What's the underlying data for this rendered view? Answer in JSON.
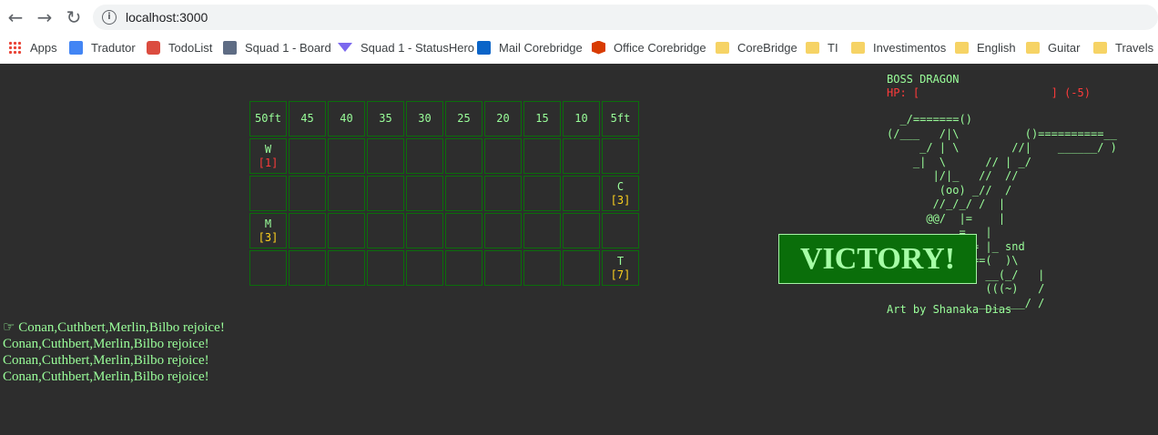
{
  "browser": {
    "url": "localhost:3000",
    "back_icon": "arrow-left-icon",
    "forward_icon": "arrow-right-icon",
    "reload_icon": "reload-icon",
    "info_icon": "info-icon",
    "bookmarks": [
      {
        "label": "Apps",
        "icon": "apps-grid-icon"
      },
      {
        "label": "Tradutor",
        "icon": "translate-icon"
      },
      {
        "label": "TodoList",
        "icon": "todoist-icon"
      },
      {
        "label": "Squad 1 - Board",
        "icon": "jira-board-icon"
      },
      {
        "label": "Squad 1 - StatusHero",
        "icon": "statushero-icon"
      },
      {
        "label": "Mail Corebridge",
        "icon": "outlook-icon"
      },
      {
        "label": "Office Corebridge",
        "icon": "office-icon"
      },
      {
        "label": "CoreBridge",
        "icon": "folder-icon"
      },
      {
        "label": "TI",
        "icon": "folder-icon"
      },
      {
        "label": "Investimentos",
        "icon": "folder-icon"
      },
      {
        "label": "English",
        "icon": "folder-icon"
      },
      {
        "label": "Guitar",
        "icon": "folder-icon"
      },
      {
        "label": "Travels",
        "icon": "folder-icon"
      }
    ]
  },
  "grid": {
    "headers": [
      "50ft",
      "45",
      "40",
      "35",
      "30",
      "25",
      "20",
      "15",
      "10",
      "5ft"
    ],
    "rows": [
      [
        {
          "letter": "W",
          "init": "[1]",
          "color": "red"
        },
        null,
        null,
        null,
        null,
        null,
        null,
        null,
        null,
        null
      ],
      [
        null,
        null,
        null,
        null,
        null,
        null,
        null,
        null,
        null,
        {
          "letter": "C",
          "init": "[3]",
          "color": "yellow"
        }
      ],
      [
        {
          "letter": "M",
          "init": "[3]",
          "color": "yellow"
        },
        null,
        null,
        null,
        null,
        null,
        null,
        null,
        null,
        null
      ],
      [
        null,
        null,
        null,
        null,
        null,
        null,
        null,
        null,
        null,
        {
          "letter": "T",
          "init": "[7]",
          "color": "yellow"
        }
      ]
    ]
  },
  "log": {
    "pointer_icon": "☞",
    "lines": [
      "Conan,Cuthbert,Merlin,Bilbo rejoice!",
      "Conan,Cuthbert,Merlin,Bilbo rejoice!",
      "Conan,Cuthbert,Merlin,Bilbo rejoice!",
      "Conan,Cuthbert,Merlin,Bilbo rejoice!"
    ]
  },
  "boss": {
    "name": "BOSS DRAGON",
    "hp_text": "HP: [                    ] (-5)",
    "art": "  _/=======()\n(/___   /|\\          ()==========__\n     _/ | \\        //|    ______/ )\n    _|  \\      // | _/\n       |/|_   //  //\n        (oo) _//  /\n       //_/_/ /  |\n      @@/  |=    |\n          _=_  |\n            == |_ snd\n          _(===(  )\\\n           (~) __(_/   |\n               (((~)   /\n              _______/ /",
    "art_credit": "Art by Shanaka Dias"
  },
  "victory": {
    "label": "VICTORY!"
  }
}
